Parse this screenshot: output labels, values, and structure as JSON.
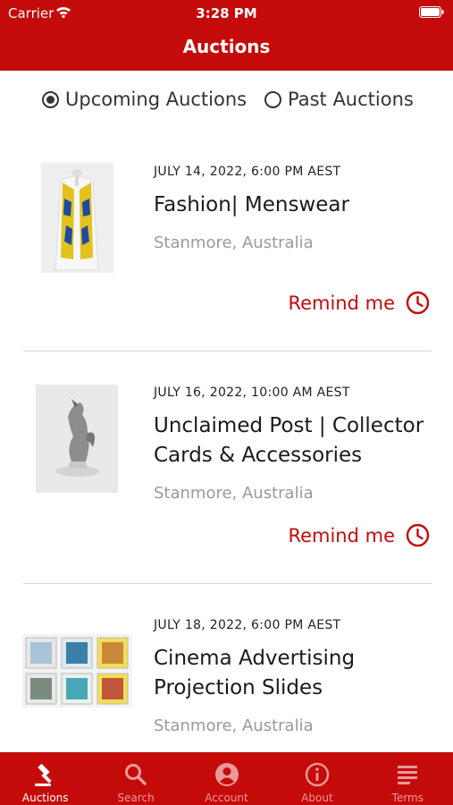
{
  "status_bar": {
    "carrier": "Carrier",
    "time": "3:28 PM"
  },
  "header": {
    "title": "Auctions"
  },
  "filter": {
    "upcoming_label": "Upcoming Auctions",
    "past_label": "Past Auctions",
    "selected": "upcoming"
  },
  "auctions": [
    {
      "date": "JULY 14, 2022, 6:00 PM AEST",
      "title": "Fashion| Menswear",
      "location": "Stanmore, Australia",
      "remind_label": "Remind me"
    },
    {
      "date": "JULY 16, 2022, 10:00 AM AEST",
      "title": "Unclaimed Post | Collector Cards & Accessories",
      "location": "Stanmore, Australia",
      "remind_label": "Remind me"
    },
    {
      "date": "JULY 18, 2022, 6:00 PM AEST",
      "title": "Cinema Advertising Projection Slides",
      "location": "Stanmore, Australia"
    }
  ],
  "tabs": [
    {
      "label": "Auctions",
      "icon": "gavel-icon",
      "active": true
    },
    {
      "label": "Search",
      "icon": "search-icon"
    },
    {
      "label": "Account",
      "icon": "account-icon"
    },
    {
      "label": "About",
      "icon": "info-icon"
    },
    {
      "label": "Terms",
      "icon": "terms-icon"
    }
  ],
  "colors": {
    "brand": "#c50a0a",
    "secondary_text": "#9a9a9a",
    "inactive_tab": "#e89a9a"
  }
}
